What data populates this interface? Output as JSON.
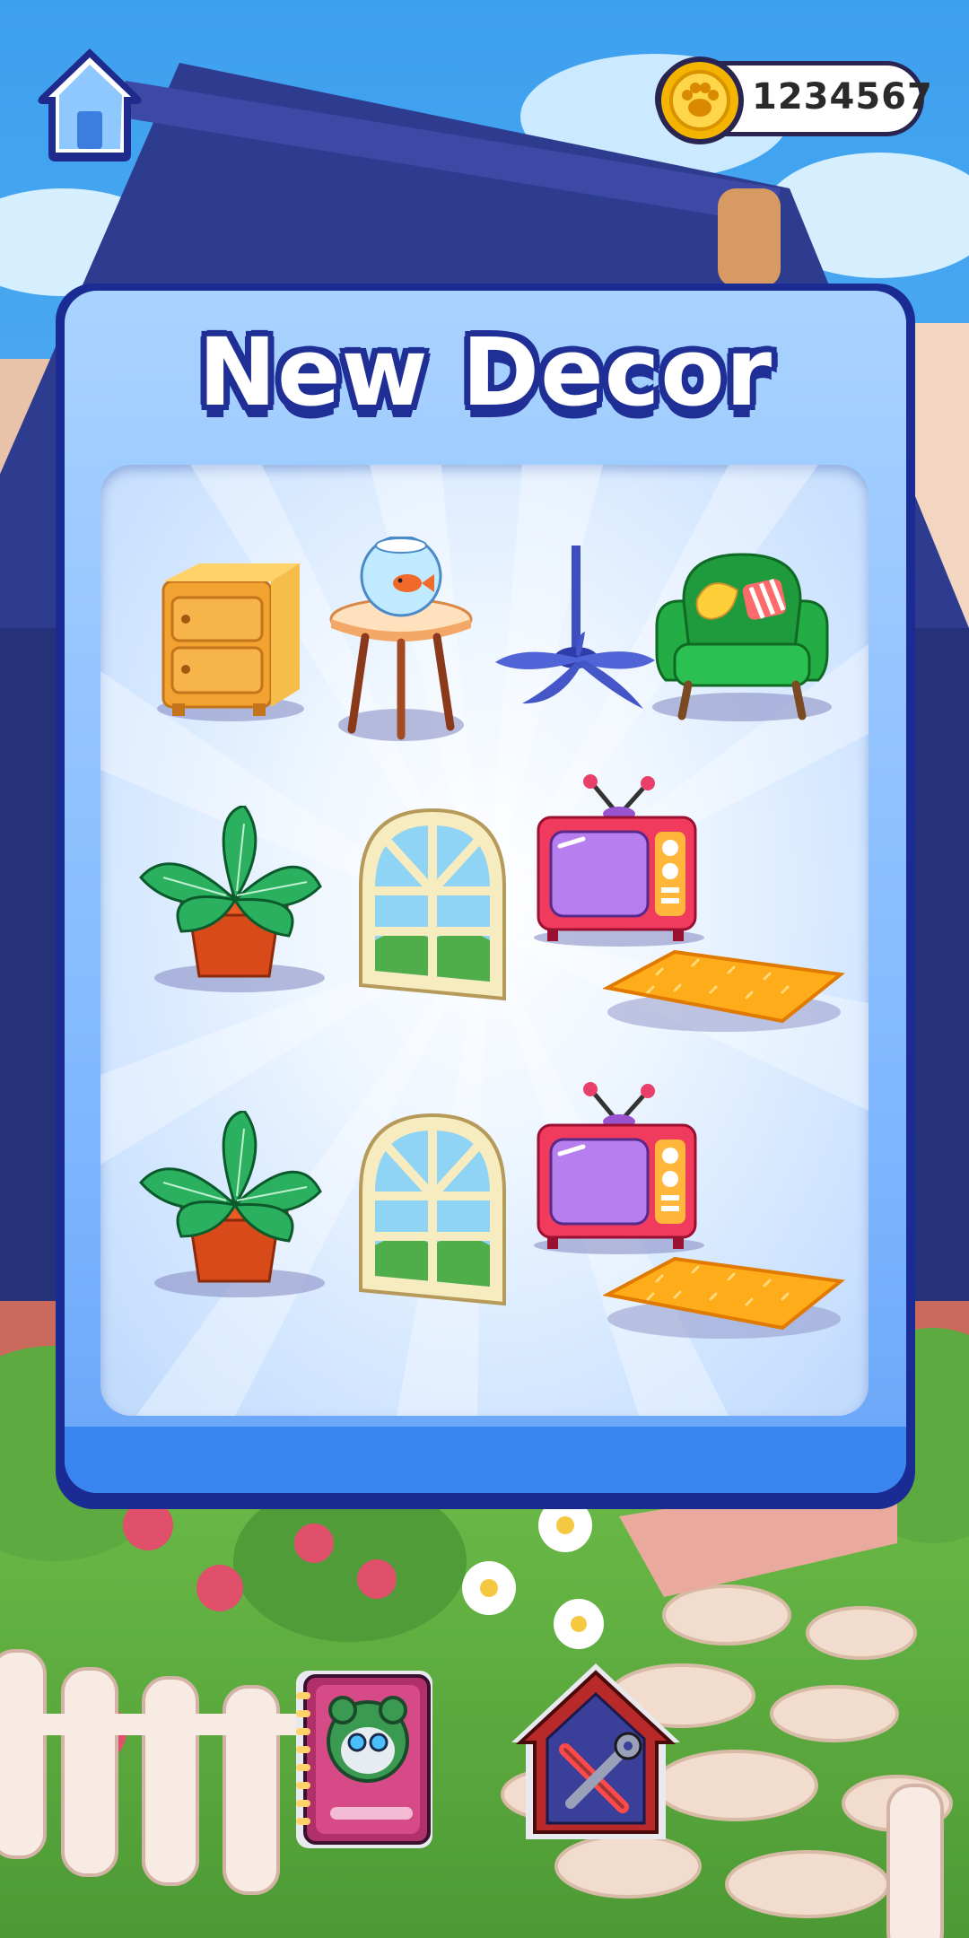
{
  "header": {
    "home_icon": "house-icon",
    "coins": "1234567",
    "coin_icon": "paw-coin-icon"
  },
  "dialog": {
    "title": "New Decor",
    "items": [
      {
        "name": "dresser",
        "icon": "dresser-icon"
      },
      {
        "name": "fishbowl-table",
        "icon": "fishbowl-icon"
      },
      {
        "name": "ceiling-fan",
        "icon": "fan-icon"
      },
      {
        "name": "armchair",
        "icon": "armchair-icon"
      },
      {
        "name": "potted-plant",
        "icon": "plant-icon"
      },
      {
        "name": "arched-window",
        "icon": "window-icon"
      },
      {
        "name": "retro-tv",
        "icon": "tv-icon"
      },
      {
        "name": "fluffy-rug",
        "icon": "rug-icon"
      },
      {
        "name": "potted-plant",
        "icon": "plant-icon"
      },
      {
        "name": "arched-window",
        "icon": "window-icon"
      },
      {
        "name": "retro-tv",
        "icon": "tv-icon"
      },
      {
        "name": "fluffy-rug",
        "icon": "rug-icon"
      }
    ]
  },
  "bottom_bar": {
    "album_icon": "album-book-icon",
    "build_icon": "build-tools-icon"
  },
  "colors": {
    "panel_border": "#1a2c93",
    "panel_fill": "#86bbff",
    "title_outline": "#1f2f96",
    "coin_gold": "#f5b400"
  }
}
